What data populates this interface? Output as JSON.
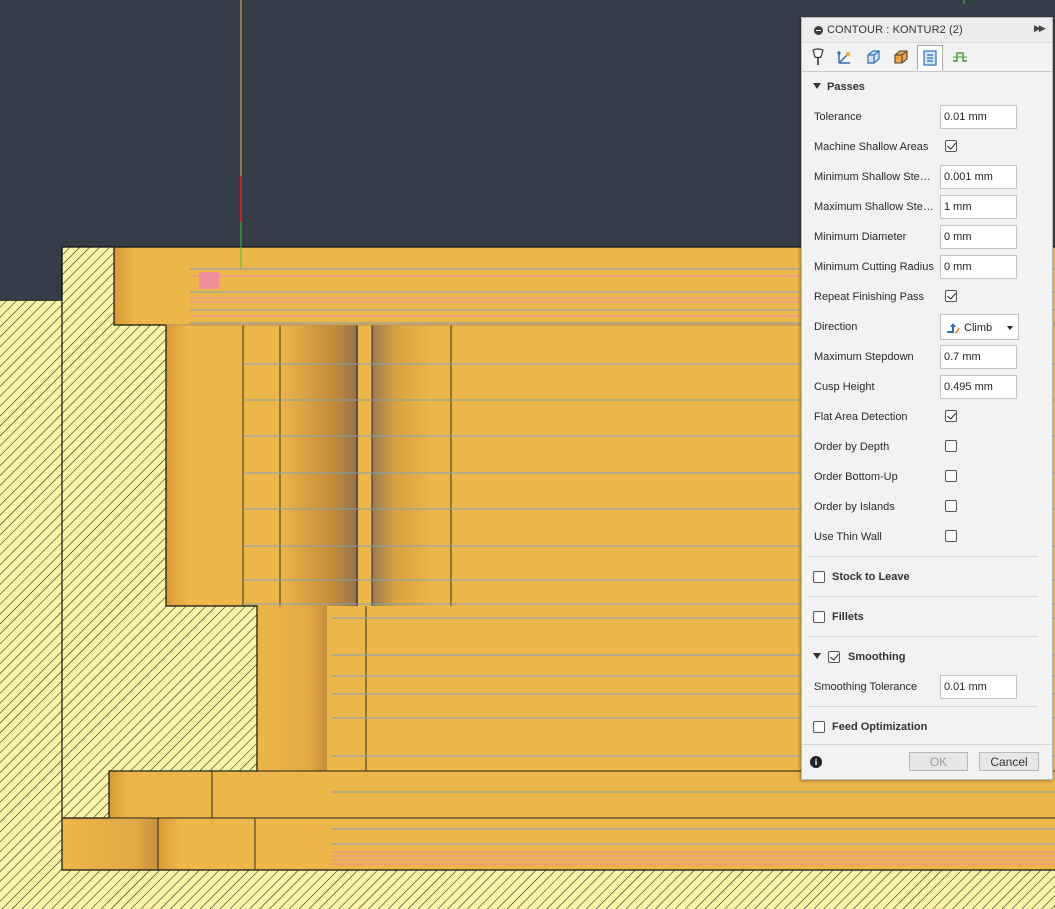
{
  "panel": {
    "title": "CONTOUR : KONTUR2 (2)",
    "expand_icon": "double-chevron-right-icon",
    "tabs": [
      {
        "icon": "tool-icon"
      },
      {
        "icon": "geometry-icon"
      },
      {
        "icon": "heights-icon"
      },
      {
        "icon": "stock-icon"
      },
      {
        "icon": "passes-icon",
        "active": true
      },
      {
        "icon": "linking-icon"
      }
    ],
    "passes": {
      "title": "Passes",
      "tolerance": {
        "label": "Tolerance",
        "value": "0.01 mm"
      },
      "machine_shallow_areas": {
        "label": "Machine Shallow Areas",
        "checked": true
      },
      "min_shallow_stepdown": {
        "label": "Minimum Shallow Stepdown",
        "value": "0.001 mm"
      },
      "max_shallow_stepdown": {
        "label": "Maximum Shallow Stepdown",
        "value": "1 mm"
      },
      "min_diameter": {
        "label": "Minimum Diameter",
        "value": "0 mm"
      },
      "min_cutting_radius": {
        "label": "Minimum Cutting Radius",
        "value": "0 mm"
      },
      "repeat_finishing_pass": {
        "label": "Repeat Finishing Pass",
        "checked": true
      },
      "direction": {
        "label": "Direction",
        "value": "Climb"
      },
      "max_stepdown": {
        "label": "Maximum Stepdown",
        "value": "0.7 mm"
      },
      "cusp_height": {
        "label": "Cusp Height",
        "value": "0.495 mm"
      },
      "flat_area_detection": {
        "label": "Flat Area Detection",
        "checked": true
      },
      "order_by_depth": {
        "label": "Order by Depth",
        "checked": false
      },
      "order_bottom_up": {
        "label": "Order Bottom-Up",
        "checked": false
      },
      "order_by_islands": {
        "label": "Order by Islands",
        "checked": false
      },
      "use_thin_wall": {
        "label": "Use Thin Wall",
        "checked": false
      }
    },
    "stock_to_leave": {
      "title": "Stock to Leave",
      "checked": false
    },
    "fillets": {
      "title": "Fillets",
      "checked": false
    },
    "smoothing": {
      "title": "Smoothing",
      "checked": true,
      "tolerance": {
        "label": "Smoothing Tolerance",
        "value": "0.01 mm"
      }
    },
    "feed_optimization": {
      "title": "Feed Optimization",
      "checked": false
    },
    "ok_label": "OK",
    "cancel_label": "Cancel"
  },
  "colors": {
    "background": "#343d48",
    "part": "#edb649",
    "section_hatch": "#f8f4a8",
    "toolpath": "#7aa3b6",
    "toolpath_highlight": "#f08aa8"
  }
}
